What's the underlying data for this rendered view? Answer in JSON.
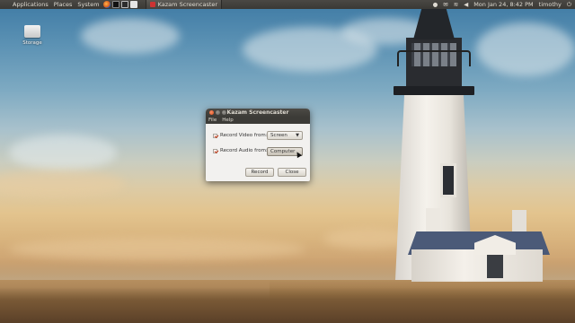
{
  "panel": {
    "menus": [
      "Applications",
      "Places",
      "System"
    ],
    "task_title": "Kazam Screencaster",
    "clock": "Mon Jan 24, 8:42 PM",
    "user": "timothy"
  },
  "desktop": {
    "icon_label": "Storage"
  },
  "window": {
    "title": "Kazam Screencaster",
    "menu": [
      "File",
      "Help"
    ],
    "video_label": "Record Video from:",
    "video_value": "Screen",
    "audio_label": "Record Audio from:",
    "audio_value": "Computer",
    "record_label": "Record",
    "close_label": "Close"
  },
  "icons": {
    "browser": "firefox-icon",
    "terminal": "terminal-icon",
    "monitor": "system-monitor-icon",
    "app": "kazam-icon"
  }
}
